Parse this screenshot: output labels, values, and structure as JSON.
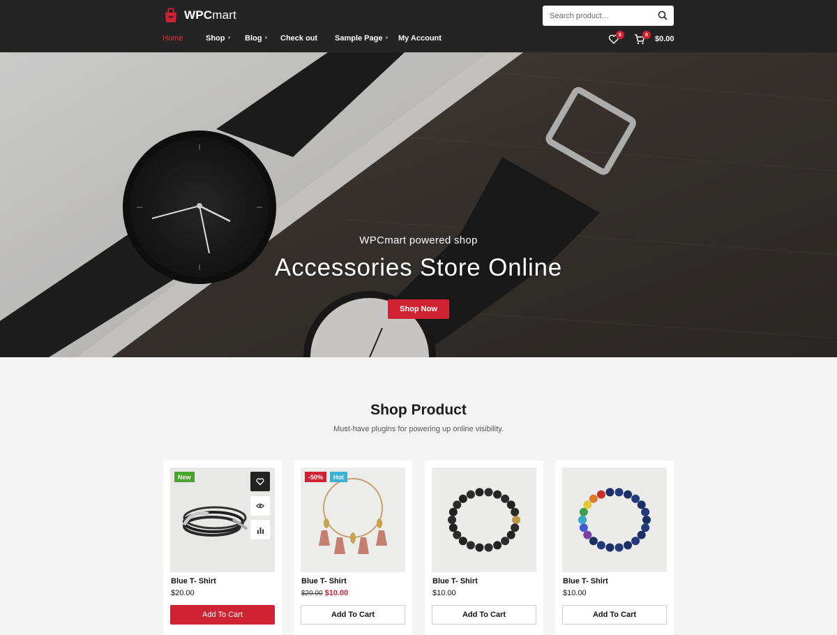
{
  "brand": {
    "name_bold": "WPC",
    "name_rest": "mart",
    "accent_color": "#cf2232"
  },
  "search": {
    "placeholder": "Search product…"
  },
  "nav": {
    "items": [
      {
        "label": "Home",
        "active": true,
        "has_submenu": false
      },
      {
        "label": "Shop",
        "active": false,
        "has_submenu": true
      },
      {
        "label": "Blog",
        "active": false,
        "has_submenu": true
      },
      {
        "label": "Check out",
        "active": false,
        "has_submenu": false
      },
      {
        "label": "Sample Page",
        "active": false,
        "has_submenu": true
      },
      {
        "label": "My Account",
        "active": false,
        "has_submenu": false
      }
    ]
  },
  "header_actions": {
    "wishlist_icon": "heart-icon",
    "wishlist_count": "0",
    "cart_icon": "cart-icon",
    "cart_count": "0",
    "cart_total": "$0.00"
  },
  "hero": {
    "subtitle": "WPCmart powered shop",
    "title": "Accessories Store Online",
    "button_label": "Shop Now"
  },
  "shop": {
    "title": "Shop Product",
    "subtitle": "Must-have plugins for powering up online visibility."
  },
  "products": [
    {
      "name": "Blue T- Shirt",
      "price": "$20.00",
      "old_price": "",
      "sale_price": "",
      "tags": [
        "New"
      ],
      "button_label": "Add To Cart",
      "image": "leather-cord-bracelet"
    },
    {
      "name": "Blue T- Shirt",
      "price": "",
      "old_price": "$20.00",
      "sale_price": "$10.00",
      "tags": [
        "-50%",
        "Hot"
      ],
      "button_label": "Add To Cart",
      "image": "tassel-bangle"
    },
    {
      "name": "Blue T- Shirt",
      "price": "$10.00",
      "old_price": "",
      "sale_price": "",
      "tags": [],
      "button_label": "Add To Cart",
      "image": "black-bead-bracelet"
    },
    {
      "name": "Blue T- Shirt",
      "price": "$10.00",
      "old_price": "",
      "sale_price": "",
      "tags": [],
      "button_label": "Add To Cart",
      "image": "chakra-bead-bracelet"
    }
  ],
  "product_actions": [
    "heart-icon",
    "eye-icon",
    "compare-icon"
  ]
}
